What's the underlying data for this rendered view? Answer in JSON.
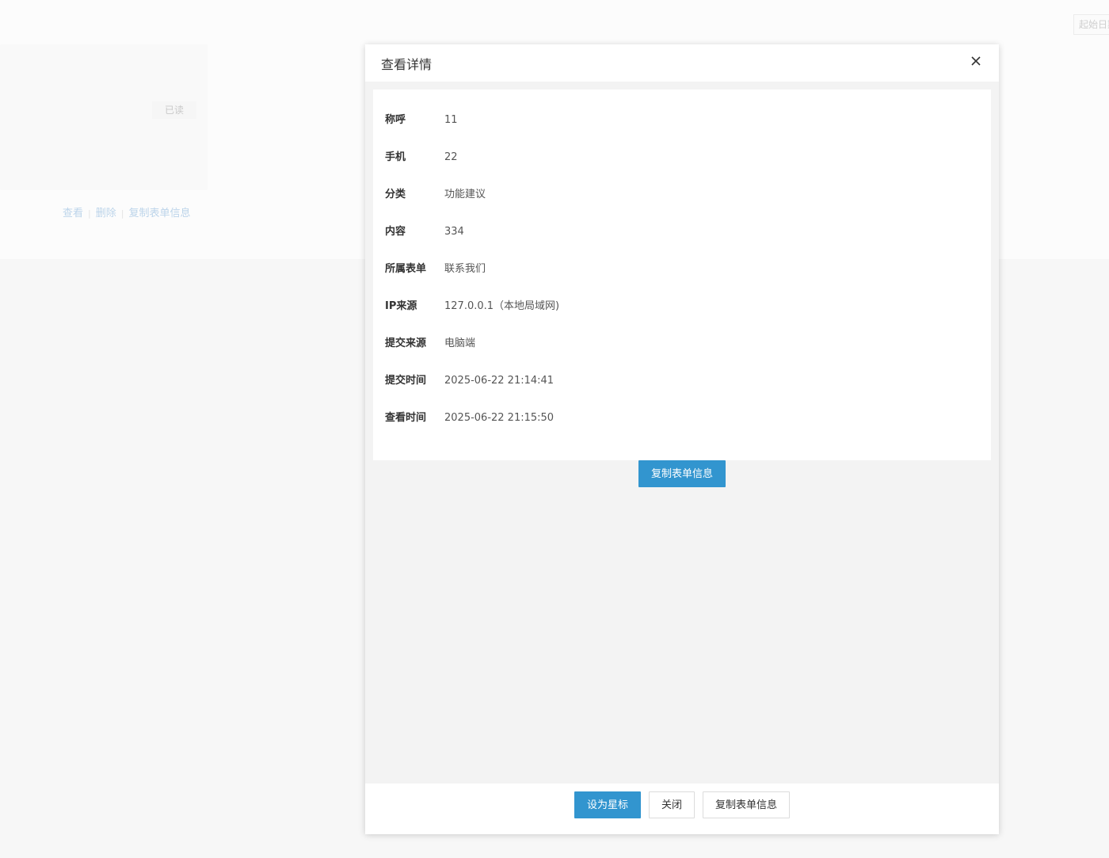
{
  "background": {
    "status_badge": "已读",
    "actions": {
      "view": "查看",
      "delete": "删除",
      "copy": "复制表单信息"
    },
    "date_input_placeholder": "起始日期"
  },
  "modal": {
    "title": "查看详情",
    "close_icon": "close-icon",
    "fields": [
      {
        "label": "称呼",
        "value": "11"
      },
      {
        "label": "手机",
        "value": "22"
      },
      {
        "label": "分类",
        "value": "功能建议"
      },
      {
        "label": "内容",
        "value": "334"
      },
      {
        "label": "所属表单",
        "value": "联系我们"
      },
      {
        "label": "IP来源",
        "value": "127.0.0.1（本地局域网)"
      },
      {
        "label": "提交来源",
        "value": "电脑端"
      },
      {
        "label": "提交时间",
        "value": "2025-06-22 21:14:41"
      },
      {
        "label": "查看时间",
        "value": "2025-06-22 21:15:50"
      }
    ],
    "copy_button": "复制表单信息",
    "footer": {
      "star_button": "设为星标",
      "close_button": "关闭",
      "copy_button": "复制表单信息"
    }
  },
  "colors": {
    "primary": "#3295cf",
    "overlay_background": "#f7f7f7"
  }
}
